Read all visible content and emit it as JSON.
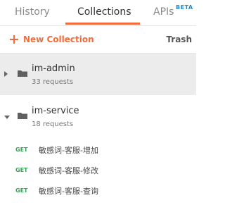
{
  "tabs": [
    {
      "label": "History"
    },
    {
      "label": "Collections"
    },
    {
      "label": "APIs",
      "badge": "BETA"
    }
  ],
  "toolbar": {
    "new_collection": "New Collection",
    "trash": "Trash"
  },
  "collections": [
    {
      "name": "im-admin",
      "count": "33 requests",
      "expanded": false
    },
    {
      "name": "im-service",
      "count": "18 requests",
      "expanded": true
    }
  ],
  "requests": [
    {
      "method": "GET",
      "name": "敏感词-客服-增加"
    },
    {
      "method": "GET",
      "name": "敏感词-客服-修改"
    },
    {
      "method": "GET",
      "name": "敏感词-客服-查询"
    }
  ],
  "colors": {
    "accent": "#f26b3a",
    "beta": "#1e88d3",
    "get_method": "#2fa84f"
  },
  "icons": [
    "plus-icon",
    "caret-right-icon",
    "caret-down-icon",
    "folder-icon"
  ]
}
